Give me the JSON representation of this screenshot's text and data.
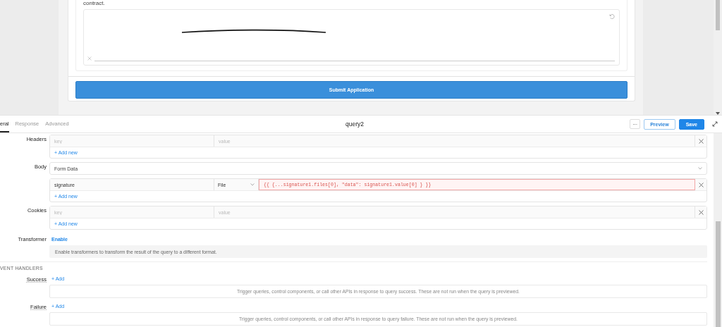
{
  "preview": {
    "text": "contract.",
    "submit_button": "Submit Application"
  },
  "query": {
    "tabs": [
      {
        "label": "eral",
        "selected": true
      },
      {
        "label": "Response",
        "selected": false
      },
      {
        "label": "Advanced",
        "selected": false
      }
    ],
    "name": "query2",
    "more_button": "···",
    "preview_button": "Preview",
    "save_button": "Save"
  },
  "sections": [
    {
      "kind": "kv",
      "label": "Headers",
      "rows": [
        {
          "kind": "empty",
          "key": {
            "placeholder": "key"
          },
          "value": {
            "placeholder": "value"
          }
        }
      ],
      "add_link": "+ Add new"
    },
    {
      "kind": "select",
      "label": "Body",
      "value": "Form Data"
    },
    {
      "kind": "kv",
      "rows": [
        {
          "kind": "file",
          "key": "signature",
          "type": "File",
          "value": "{{ {...signature1.files[0], \"data\": signature1.value[0] } }}",
          "invalid": true
        }
      ],
      "add_link": "+ Add new"
    },
    {
      "kind": "kv",
      "label": "Cookies",
      "rows": [
        {
          "kind": "empty",
          "key": {
            "placeholder": "key"
          },
          "value": {
            "placeholder": "value"
          }
        }
      ],
      "add_link": "+ Add new"
    },
    {
      "kind": "toggle",
      "label": "Transformer",
      "link": "Enable",
      "description": "Enable transformers to transform the result of the query to a different format."
    }
  ],
  "event_handlers": {
    "title": "VENT HANDLERS",
    "handlers": [
      {
        "label": "Success",
        "add_link": "+ Add",
        "description": "Trigger queries, control components, or call other APIs in response to query success. These are not run when the query is previewed."
      },
      {
        "label": "Failure",
        "add_link": "+ Add",
        "description": "Trigger queries, control components, or call other APIs in response to query failure. These are not run when the query is previewed."
      }
    ]
  }
}
